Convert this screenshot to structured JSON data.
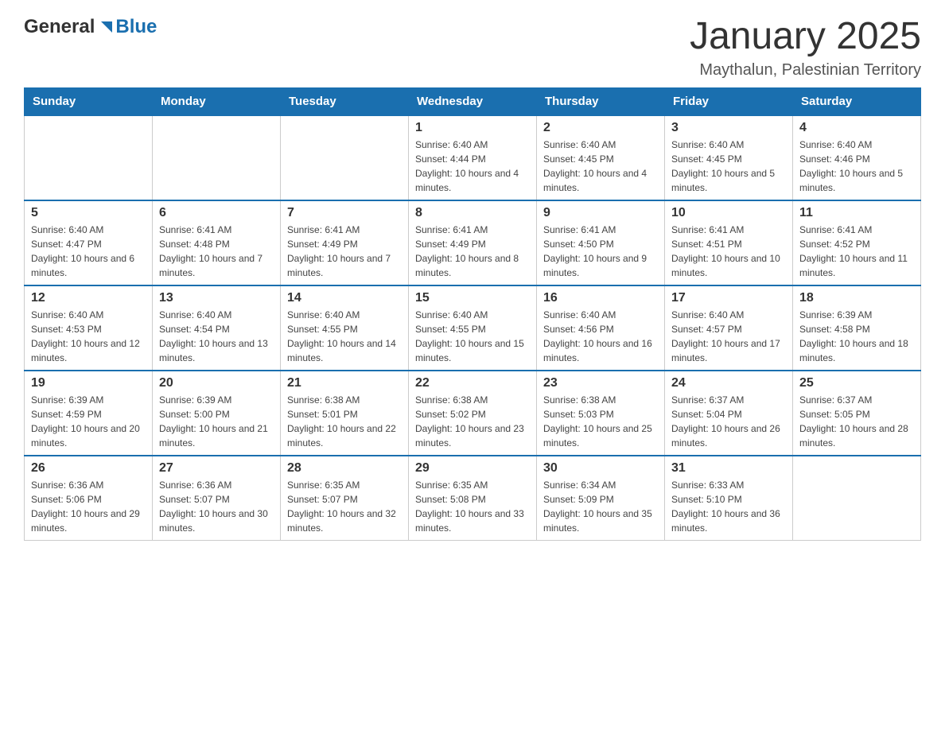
{
  "header": {
    "logo_general": "General",
    "logo_blue": "Blue",
    "title": "January 2025",
    "subtitle": "Maythalun, Palestinian Territory"
  },
  "days_of_week": [
    "Sunday",
    "Monday",
    "Tuesday",
    "Wednesday",
    "Thursday",
    "Friday",
    "Saturday"
  ],
  "weeks": [
    {
      "days": [
        {
          "number": "",
          "info": ""
        },
        {
          "number": "",
          "info": ""
        },
        {
          "number": "",
          "info": ""
        },
        {
          "number": "1",
          "info": "Sunrise: 6:40 AM\nSunset: 4:44 PM\nDaylight: 10 hours and 4 minutes."
        },
        {
          "number": "2",
          "info": "Sunrise: 6:40 AM\nSunset: 4:45 PM\nDaylight: 10 hours and 4 minutes."
        },
        {
          "number": "3",
          "info": "Sunrise: 6:40 AM\nSunset: 4:45 PM\nDaylight: 10 hours and 5 minutes."
        },
        {
          "number": "4",
          "info": "Sunrise: 6:40 AM\nSunset: 4:46 PM\nDaylight: 10 hours and 5 minutes."
        }
      ]
    },
    {
      "days": [
        {
          "number": "5",
          "info": "Sunrise: 6:40 AM\nSunset: 4:47 PM\nDaylight: 10 hours and 6 minutes."
        },
        {
          "number": "6",
          "info": "Sunrise: 6:41 AM\nSunset: 4:48 PM\nDaylight: 10 hours and 7 minutes."
        },
        {
          "number": "7",
          "info": "Sunrise: 6:41 AM\nSunset: 4:49 PM\nDaylight: 10 hours and 7 minutes."
        },
        {
          "number": "8",
          "info": "Sunrise: 6:41 AM\nSunset: 4:49 PM\nDaylight: 10 hours and 8 minutes."
        },
        {
          "number": "9",
          "info": "Sunrise: 6:41 AM\nSunset: 4:50 PM\nDaylight: 10 hours and 9 minutes."
        },
        {
          "number": "10",
          "info": "Sunrise: 6:41 AM\nSunset: 4:51 PM\nDaylight: 10 hours and 10 minutes."
        },
        {
          "number": "11",
          "info": "Sunrise: 6:41 AM\nSunset: 4:52 PM\nDaylight: 10 hours and 11 minutes."
        }
      ]
    },
    {
      "days": [
        {
          "number": "12",
          "info": "Sunrise: 6:40 AM\nSunset: 4:53 PM\nDaylight: 10 hours and 12 minutes."
        },
        {
          "number": "13",
          "info": "Sunrise: 6:40 AM\nSunset: 4:54 PM\nDaylight: 10 hours and 13 minutes."
        },
        {
          "number": "14",
          "info": "Sunrise: 6:40 AM\nSunset: 4:55 PM\nDaylight: 10 hours and 14 minutes."
        },
        {
          "number": "15",
          "info": "Sunrise: 6:40 AM\nSunset: 4:55 PM\nDaylight: 10 hours and 15 minutes."
        },
        {
          "number": "16",
          "info": "Sunrise: 6:40 AM\nSunset: 4:56 PM\nDaylight: 10 hours and 16 minutes."
        },
        {
          "number": "17",
          "info": "Sunrise: 6:40 AM\nSunset: 4:57 PM\nDaylight: 10 hours and 17 minutes."
        },
        {
          "number": "18",
          "info": "Sunrise: 6:39 AM\nSunset: 4:58 PM\nDaylight: 10 hours and 18 minutes."
        }
      ]
    },
    {
      "days": [
        {
          "number": "19",
          "info": "Sunrise: 6:39 AM\nSunset: 4:59 PM\nDaylight: 10 hours and 20 minutes."
        },
        {
          "number": "20",
          "info": "Sunrise: 6:39 AM\nSunset: 5:00 PM\nDaylight: 10 hours and 21 minutes."
        },
        {
          "number": "21",
          "info": "Sunrise: 6:38 AM\nSunset: 5:01 PM\nDaylight: 10 hours and 22 minutes."
        },
        {
          "number": "22",
          "info": "Sunrise: 6:38 AM\nSunset: 5:02 PM\nDaylight: 10 hours and 23 minutes."
        },
        {
          "number": "23",
          "info": "Sunrise: 6:38 AM\nSunset: 5:03 PM\nDaylight: 10 hours and 25 minutes."
        },
        {
          "number": "24",
          "info": "Sunrise: 6:37 AM\nSunset: 5:04 PM\nDaylight: 10 hours and 26 minutes."
        },
        {
          "number": "25",
          "info": "Sunrise: 6:37 AM\nSunset: 5:05 PM\nDaylight: 10 hours and 28 minutes."
        }
      ]
    },
    {
      "days": [
        {
          "number": "26",
          "info": "Sunrise: 6:36 AM\nSunset: 5:06 PM\nDaylight: 10 hours and 29 minutes."
        },
        {
          "number": "27",
          "info": "Sunrise: 6:36 AM\nSunset: 5:07 PM\nDaylight: 10 hours and 30 minutes."
        },
        {
          "number": "28",
          "info": "Sunrise: 6:35 AM\nSunset: 5:07 PM\nDaylight: 10 hours and 32 minutes."
        },
        {
          "number": "29",
          "info": "Sunrise: 6:35 AM\nSunset: 5:08 PM\nDaylight: 10 hours and 33 minutes."
        },
        {
          "number": "30",
          "info": "Sunrise: 6:34 AM\nSunset: 5:09 PM\nDaylight: 10 hours and 35 minutes."
        },
        {
          "number": "31",
          "info": "Sunrise: 6:33 AM\nSunset: 5:10 PM\nDaylight: 10 hours and 36 minutes."
        },
        {
          "number": "",
          "info": ""
        }
      ]
    }
  ]
}
